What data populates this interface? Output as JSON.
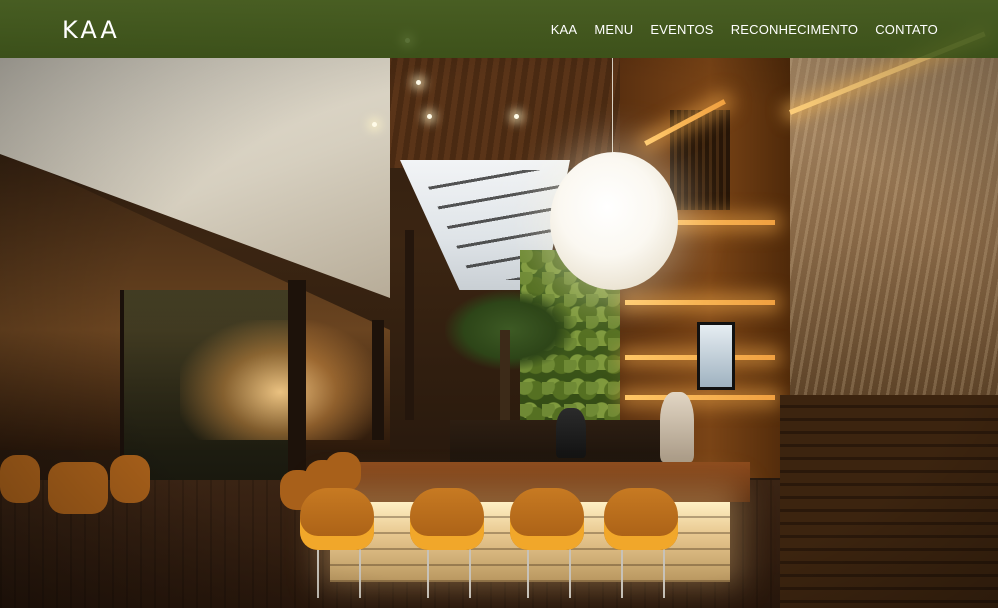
{
  "brand": {
    "logo_text": "KAA"
  },
  "nav": {
    "items": [
      {
        "label": "KAA"
      },
      {
        "label": "MENU"
      },
      {
        "label": "EVENTOS"
      },
      {
        "label": "RECONHECIMENTO"
      },
      {
        "label": "CONTATO"
      }
    ]
  },
  "hero": {
    "image_subject": "restaurant-interior-photo"
  },
  "colors": {
    "header_bg": "#4e6826",
    "nav_text": "#ffffff",
    "logo_text": "#ffffff"
  }
}
